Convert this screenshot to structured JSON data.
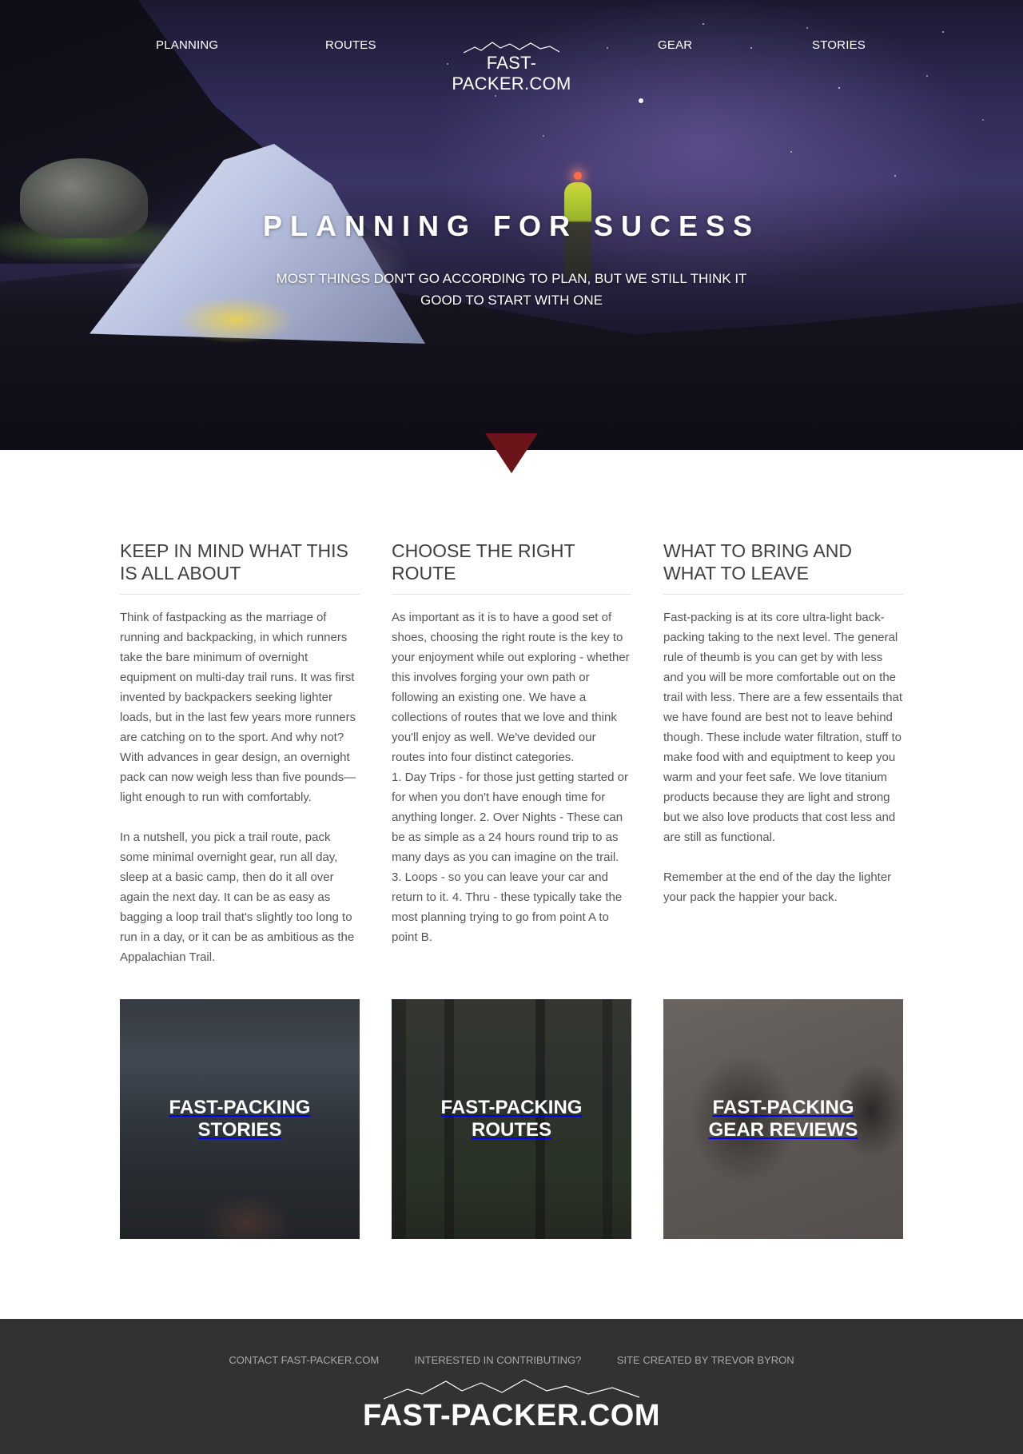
{
  "nav": {
    "planning": "PLANNING",
    "routes": "ROUTES",
    "brand": "FAST-PACKER.COM",
    "gear": "GEAR",
    "stories": "STORIES"
  },
  "hero": {
    "title": "PLANNING FOR SUCESS",
    "subtitle": "MOST THINGS DON'T GO ACCORDING TO PLAN, BUT WE STILL THINK IT GOOD TO START WITH ONE"
  },
  "columns": [
    {
      "heading": "KEEP IN MIND WHAT THIS IS ALL ABOUT",
      "paragraphs": [
        "Think of fastpacking as the marriage of running and backpacking, in which runners take the bare minimum of overnight equipment on multi-day trail runs. It was first invented by backpackers seeking lighter loads, but in the last few years more runners are catching on to the sport. And why not? With advances in gear design, an overnight pack can now weigh less than five pounds—light enough to run with comfortably.",
        "In a nutshell, you pick a trail route, pack some minimal overnight gear, run all day, sleep at a basic camp, then do it all over again the next day. It can be as easy as bagging a loop trail that's slightly too long to run in a day, or it can be as ambitious as the Appalachian Trail."
      ]
    },
    {
      "heading": "CHOOSE THE RIGHT ROUTE",
      "paragraphs": [
        "As important as it is to have a good set of shoes, choosing the right route is the key to your enjoyment while out exploring - whether this involves forging your own path or following an existing one. We have a collections of routes that we love and think you'll enjoy as well. We've devided our routes into four distinct categories.\n1. Day Trips - for those just getting started or for when you don't have enough time for anything longer. 2. Over Nights - These can be as simple as a 24 hours round trip to as many days as you can imagine on the trail. 3. Loops - so you can leave your car and return to it. 4. Thru - these typically take the most planning trying to go from point A to point B."
      ]
    },
    {
      "heading": "WHAT TO BRING AND WHAT TO LEAVE",
      "paragraphs": [
        "Fast-packing is at its core ultra-light back-packing taking to the next level. The general rule of theumb is you can get by with less and you will be more comfortable out on the trail with less. There are a few essentails that we have found are best not to leave behind though. These include water filtration, stuff to make food with and equiptment to keep you warm and your feet safe. We love titanium products because they are light and strong but we also love products that cost less and are still as functional.",
        "Remember at the end of the day the lighter your pack the happier your back."
      ]
    }
  ],
  "cards": [
    {
      "label": "FAST-PACKING STORIES"
    },
    {
      "label": "FAST-PACKING ROUTES"
    },
    {
      "label": "FAST-PACKING GEAR REVIEWS"
    }
  ],
  "footer": {
    "links": [
      "CONTACT FAST-PACKER.COM",
      "INTERESTED IN CONTRIBUTING?",
      "SITE CREATED BY TREVOR BYRON"
    ],
    "brand": "FAST-PACKER.COM"
  },
  "colors": {
    "accent_arrow": "#6b1419",
    "footer_bg": "#323232",
    "footer_link": "#a9a9a9"
  }
}
